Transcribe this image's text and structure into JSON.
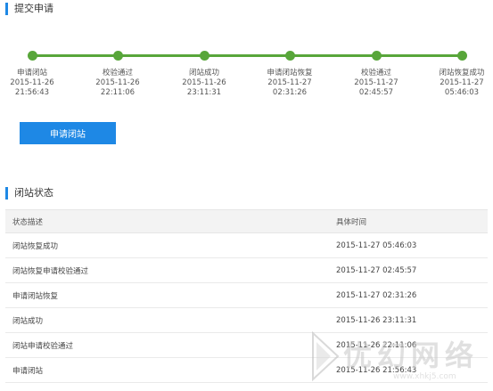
{
  "submit_section": {
    "title": "提交申请"
  },
  "timeline": {
    "steps": [
      {
        "label": "申请闭站",
        "date": "2015-11-26",
        "time": "21:56:43"
      },
      {
        "label": "校验通过",
        "date": "2015-11-26",
        "time": "22:11:06"
      },
      {
        "label": "闭站成功",
        "date": "2015-11-26",
        "time": "23:11:31"
      },
      {
        "label": "申请闭站恢复",
        "date": "2015-11-27",
        "time": "02:31:26"
      },
      {
        "label": "校验通过",
        "date": "2015-11-27",
        "time": "02:45:57"
      },
      {
        "label": "闭站恢复成功",
        "date": "2015-11-27",
        "time": "05:46:03"
      }
    ],
    "color": "#58a63a"
  },
  "actions": {
    "close_site_label": "申请闭站"
  },
  "status_section": {
    "title": "闭站状态",
    "columns": [
      "状态描述",
      "具体时间"
    ],
    "rows": [
      [
        "闭站恢复成功",
        "2015-11-27 05:46:03"
      ],
      [
        "闭站恢复申请校验通过",
        "2015-11-27 02:45:57"
      ],
      [
        "申请闭站恢复",
        "2015-11-27 02:31:26"
      ],
      [
        "闭站成功",
        "2015-11-26 23:11:31"
      ],
      [
        "闭站申请校验通过",
        "2015-11-26 22:11:06"
      ],
      [
        "申请闭站",
        "2015-11-26 21:56:43"
      ]
    ]
  },
  "watermark": {
    "text": "优幻网络",
    "url": "www.xhkj5.com"
  },
  "colors": {
    "accent": "#1e88e5",
    "progress": "#58a63a"
  }
}
